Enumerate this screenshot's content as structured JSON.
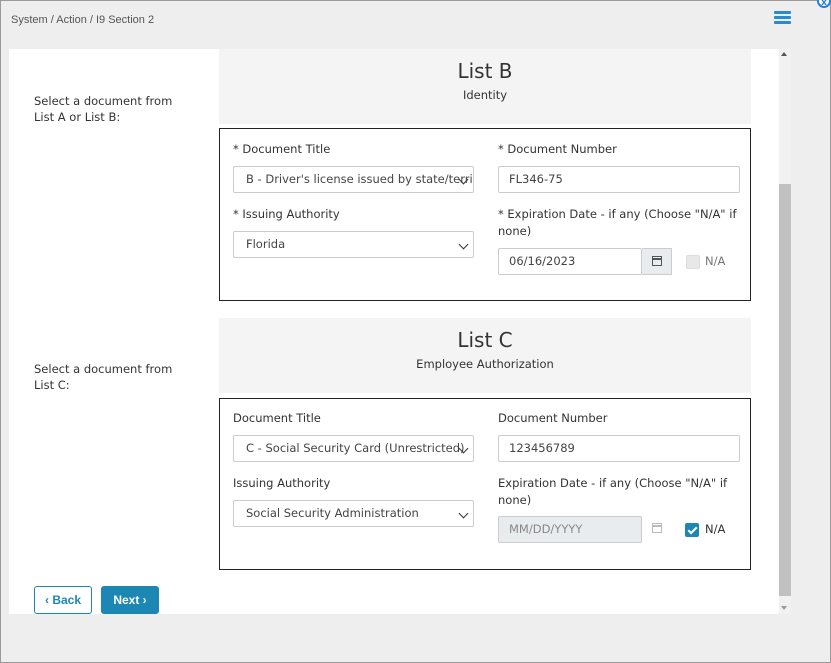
{
  "breadcrumb": "System / Action / I9 Section 2",
  "icons": {
    "menu": "menu-list-icon",
    "corner": "corner-badge-icon"
  },
  "accent_color": "#1d87b4",
  "list_b": {
    "side_label": "Select a document from List A or List B:",
    "title": "List B",
    "subtitle": "Identity",
    "doc_title_label": "* Document Title",
    "doc_title_value": "B - Driver's license issued by state/territory",
    "doc_number_label": "* Document Number",
    "doc_number_value": "FL346-75",
    "issuing_label": "* Issuing Authority",
    "issuing_value": "Florida",
    "exp_label": "* Expiration Date - if any (Choose \"N/A\" if none)",
    "exp_value": "06/16/2023",
    "na_label": "N/A",
    "na_checked": false
  },
  "list_c": {
    "side_label": "Select a document from List C:",
    "title": "List C",
    "subtitle": "Employee Authorization",
    "doc_title_label": "Document Title",
    "doc_title_value": "C - Social Security Card (Unrestricted)",
    "doc_number_label": "Document Number",
    "doc_number_value": "123456789",
    "issuing_label": "Issuing Authority",
    "issuing_value": "Social Security Administration",
    "exp_label": "Expiration Date - if any (Choose \"N/A\" if none)",
    "exp_placeholder": "MM/DD/YYYY",
    "na_label": "N/A",
    "na_checked": true
  },
  "buttons": {
    "back": "Back",
    "next": "Next"
  }
}
